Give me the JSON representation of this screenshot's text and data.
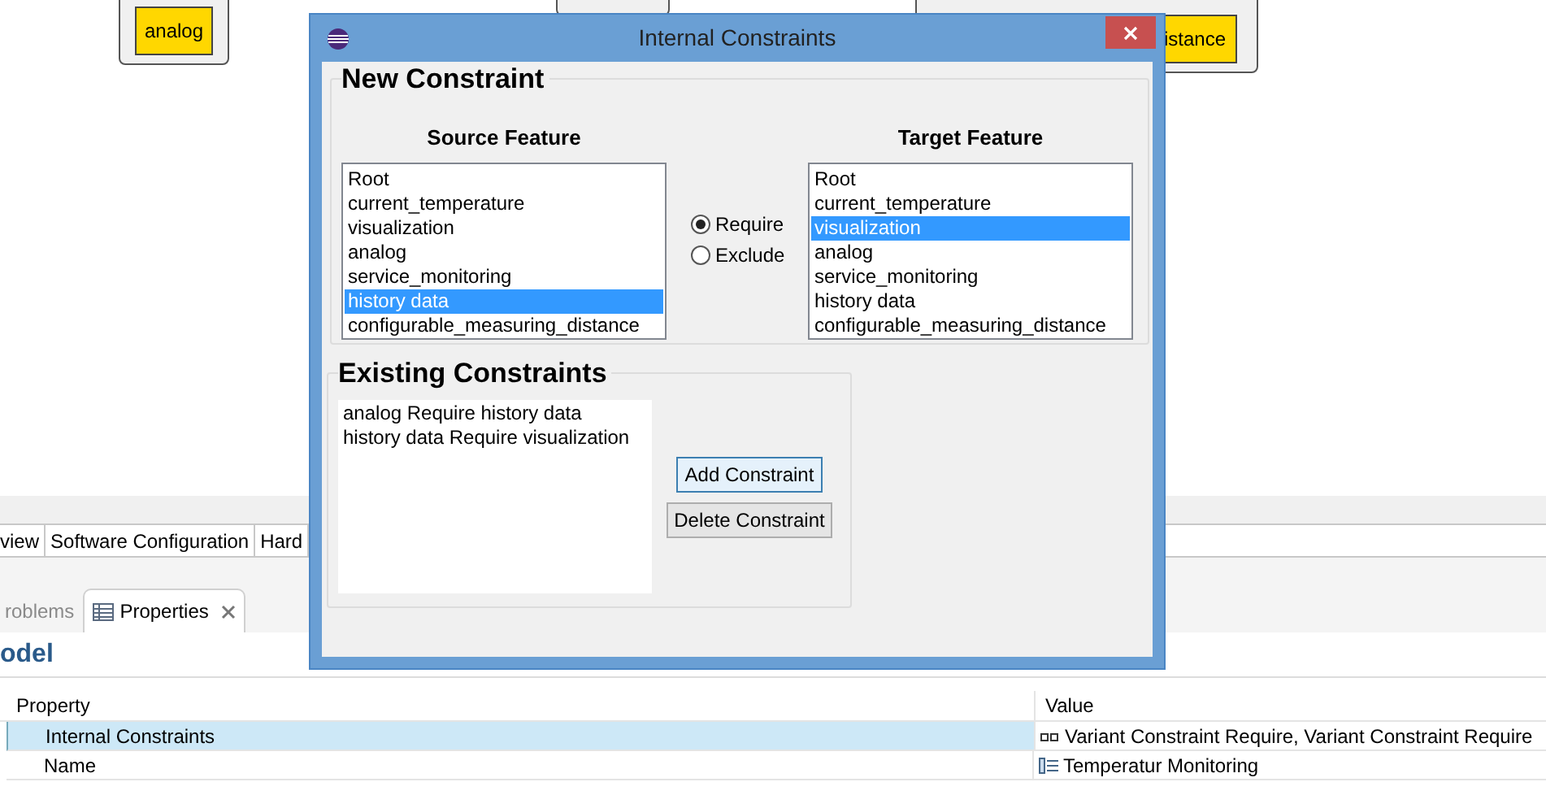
{
  "diagram": {
    "nodes": [
      {
        "label": "analog"
      },
      {
        "label": "istance"
      }
    ]
  },
  "editor_tabs": [
    {
      "label": "view"
    },
    {
      "label": "Software Configuration"
    },
    {
      "label": "Hard"
    }
  ],
  "view_tabs": [
    {
      "label": "roblems",
      "selected": false
    },
    {
      "label": "Properties",
      "selected": true
    }
  ],
  "properties": {
    "title": "odel",
    "columns": [
      "Property",
      "Value"
    ],
    "rows": [
      {
        "property": "Internal Constraints",
        "value": "Variant Constraint Require, Variant Constraint Require",
        "selected": true
      },
      {
        "property": "Name",
        "value": "Temperatur Monitoring",
        "selected": false
      }
    ]
  },
  "dialog": {
    "title": "Internal Constraints",
    "new_constraint": {
      "title": "New Constraint",
      "source": {
        "title": "Source Feature",
        "items": [
          {
            "label": "Root",
            "selected": false
          },
          {
            "label": "current_temperature",
            "selected": false
          },
          {
            "label": "visualization",
            "selected": false
          },
          {
            "label": "analog",
            "selected": false
          },
          {
            "label": "service_monitoring",
            "selected": false
          },
          {
            "label": "history data",
            "selected": true
          },
          {
            "label": "configurable_measuring_distance",
            "selected": false
          }
        ]
      },
      "options": [
        {
          "label": "Require",
          "selected": true
        },
        {
          "label": "Exclude",
          "selected": false
        }
      ],
      "target": {
        "title": "Target Feature",
        "items": [
          {
            "label": "Root",
            "selected": false
          },
          {
            "label": "current_temperature",
            "selected": false
          },
          {
            "label": "visualization",
            "selected": true
          },
          {
            "label": "analog",
            "selected": false
          },
          {
            "label": "service_monitoring",
            "selected": false
          },
          {
            "label": "history data",
            "selected": false
          },
          {
            "label": "configurable_measuring_distance",
            "selected": false
          }
        ]
      }
    },
    "existing": {
      "title": "Existing Constraints",
      "items": [
        "analog Require history data",
        "history data Require visualization"
      ],
      "buttons": [
        {
          "label": "Add Constraint",
          "default": true
        },
        {
          "label": "Delete Constraint",
          "default": false
        }
      ]
    }
  }
}
